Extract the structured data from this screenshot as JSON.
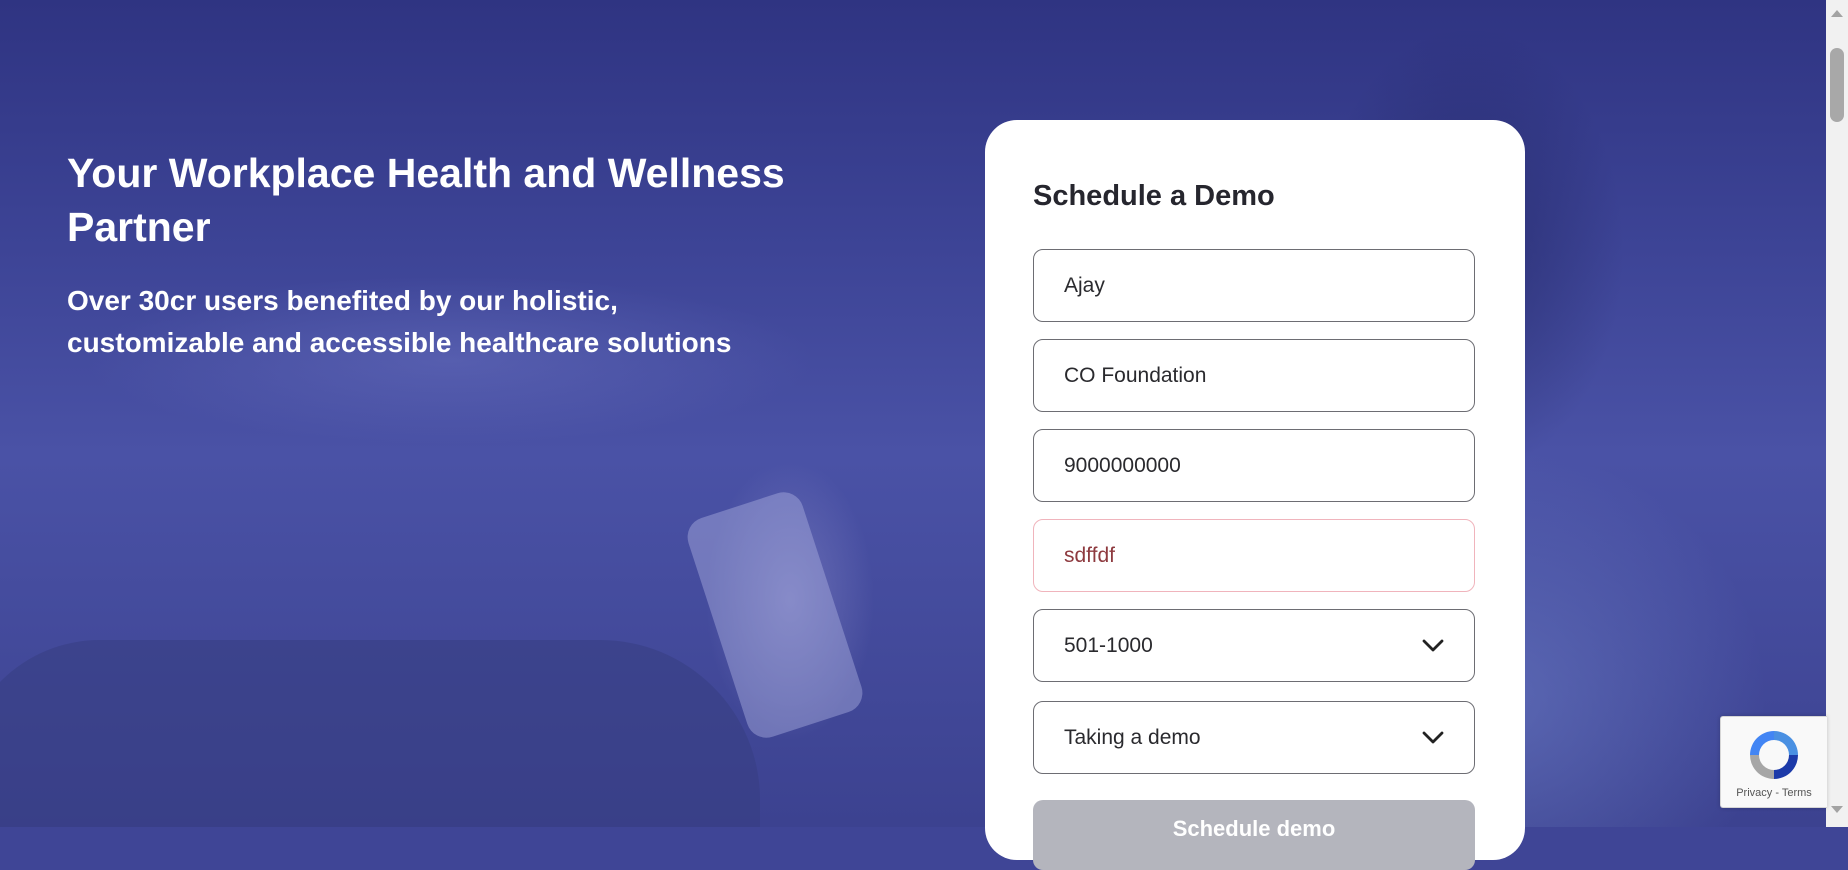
{
  "hero": {
    "title": "Your Workplace Health and Wellness Partner",
    "subtitle": "Over 30cr users benefited by our holistic, customizable and accessible healthcare solutions"
  },
  "form": {
    "title": "Schedule a Demo",
    "name_value": "Ajay",
    "company_value": "CO Foundation",
    "phone_value": "9000000000",
    "email_value": "sdffdf",
    "employee_count_selected": "501-1000",
    "purpose_selected": "Taking a demo",
    "submit_label": "Schedule demo"
  },
  "recaptcha": {
    "privacy_label": "Privacy",
    "separator": "-",
    "terms_label": "Terms"
  },
  "colors": {
    "hero_overlay": "#3f4596",
    "card_background": "#ffffff",
    "field_border": "#6d6d73",
    "error_border": "#f0b4bc",
    "error_text": "#8e3a3f",
    "submit_disabled": "#b4b5bd"
  }
}
